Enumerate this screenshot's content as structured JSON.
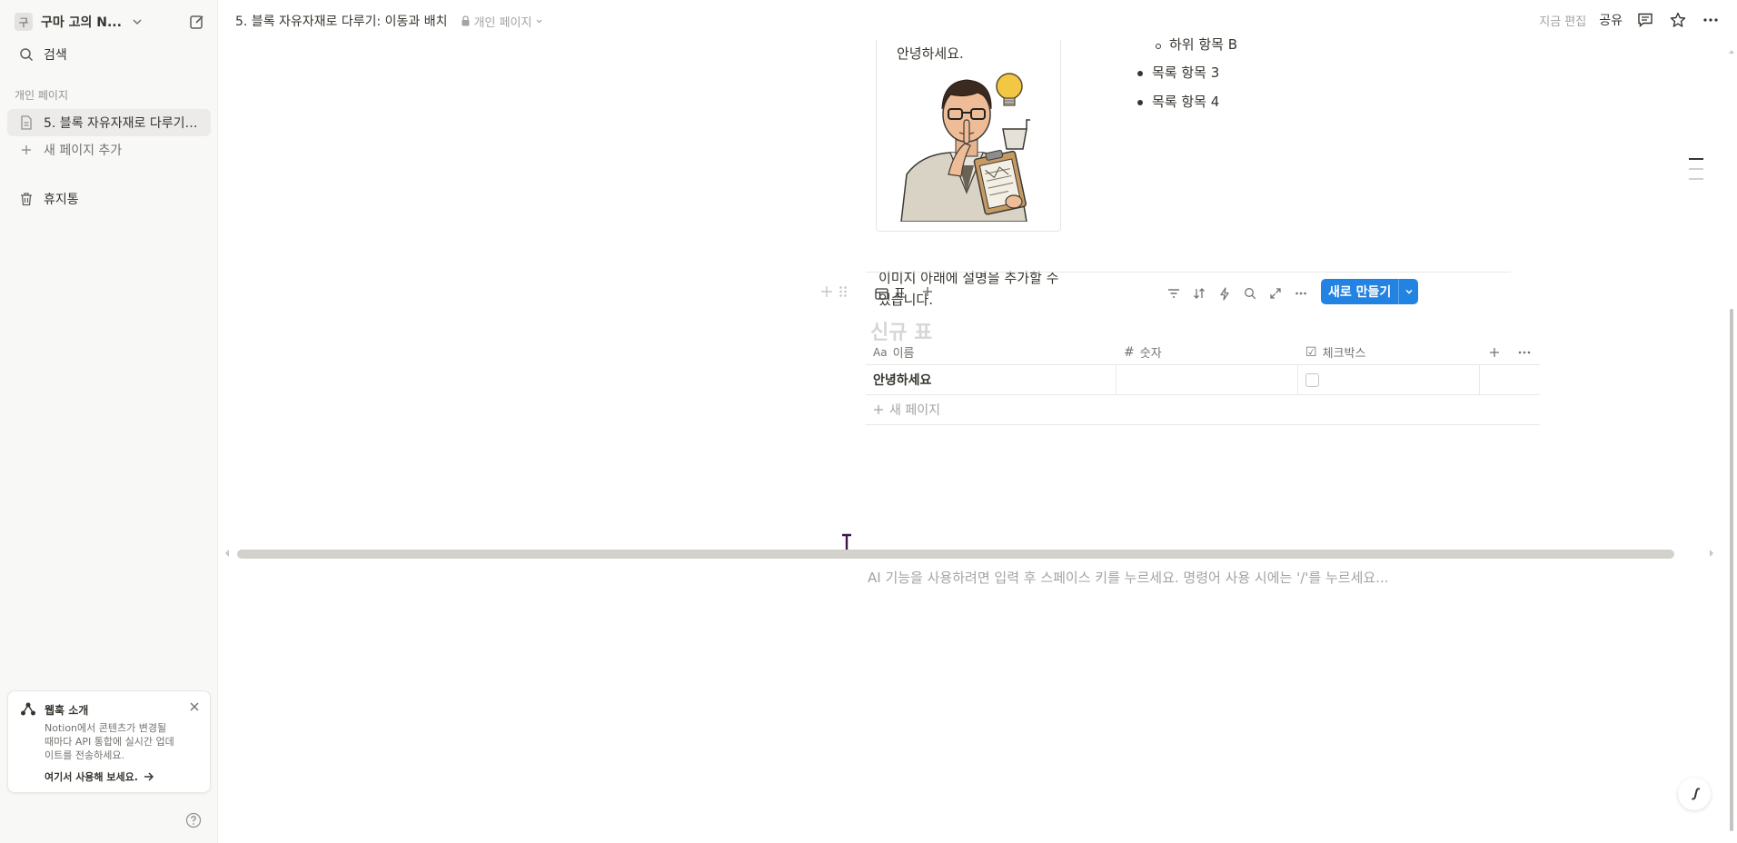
{
  "sidebar": {
    "workspace_avatar": "구",
    "workspace_name": "구마 고의 N...",
    "search_label": "검색",
    "section_label": "개인 페이지",
    "page_item_label": "5. 블록 자유자재로 다루기: ...",
    "add_page_label": "새 페이지 추가",
    "trash_label": "휴지통",
    "webhook_card": {
      "title": "웹훅 소개",
      "body": "Notion에서 콘텐츠가 변경될 때마다 API 통합에 실시간 업데이트를 전송하세요.",
      "cta": "여기서 사용해 보세요."
    }
  },
  "topbar": {
    "page_title": "5. 블록 자유자재로 다루기: 이동과 배치",
    "privacy_label": "개인 페이지",
    "edit_status": "지금 편집",
    "share_label": "공유"
  },
  "content": {
    "image_block_text": "안녕하세요.",
    "caption": "이미지 아래에 설명을 추가할 수 있습니다.",
    "list_items": [
      "하위 항목 B",
      "목록 항목 3",
      "목록 항목 4"
    ],
    "editor_placeholder": "AI 기능을 사용하려면 입력 후 스페이스 키를 누르세요. 명령어 사용 시에는 '/'를 누르세요..."
  },
  "database": {
    "view_tab_label": "표",
    "new_button_label": "새로 만들기",
    "title": "신규 표",
    "columns": [
      {
        "icon_text": "Aa",
        "label": "이름"
      },
      {
        "icon_text": "#",
        "label": "숫자"
      },
      {
        "icon_text": "☑",
        "label": "체크박스"
      }
    ],
    "rows": [
      {
        "name": "안녕하세요",
        "number": "",
        "checked": false
      }
    ],
    "new_row_label": "새 페이지"
  },
  "colors": {
    "accent": "#2383e2",
    "text": "#37352f",
    "muted": "#a4a3a0",
    "sidebar_bg": "#f8f8f7"
  }
}
